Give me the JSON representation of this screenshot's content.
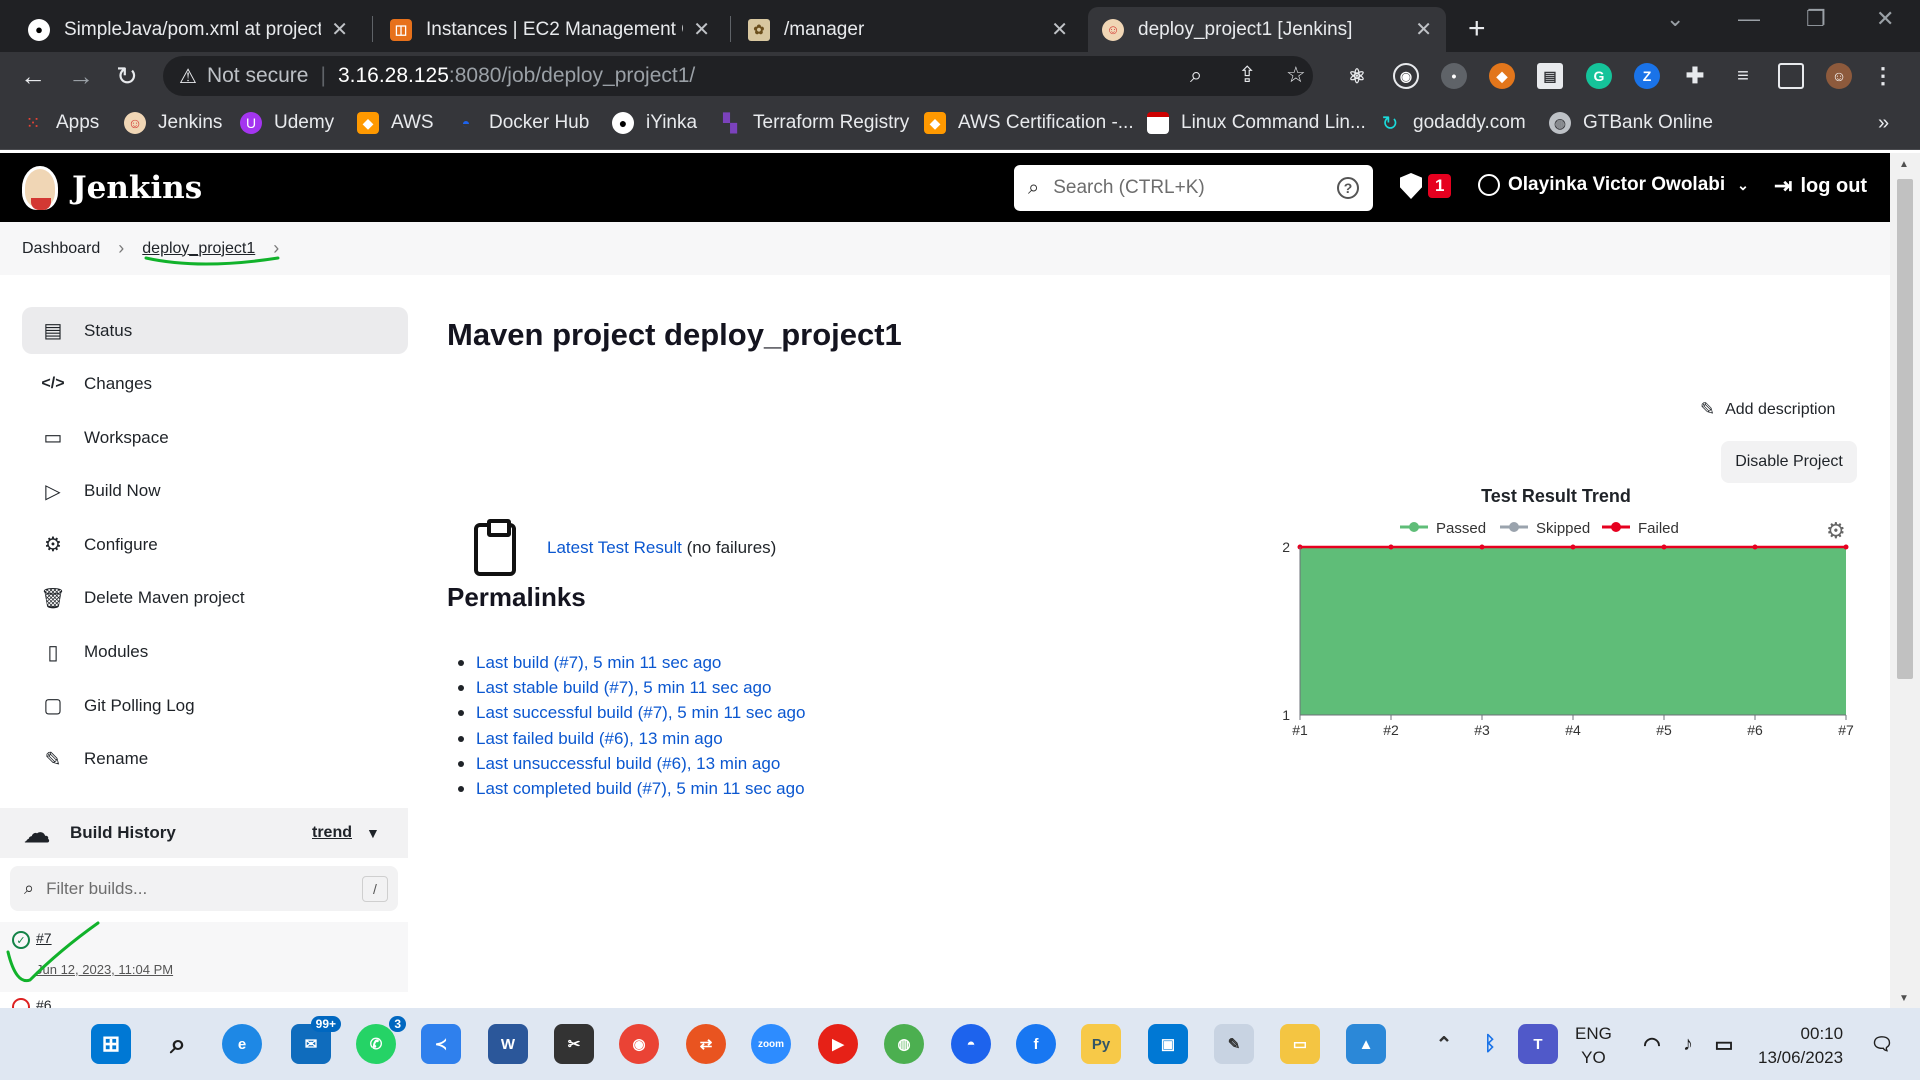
{
  "browser": {
    "tabs": [
      {
        "title": "SimpleJava/pom.xml at project1 ·",
        "favicon": "github-icon"
      },
      {
        "title": "Instances | EC2 Management Con",
        "favicon": "aws-icon"
      },
      {
        "title": "/manager",
        "favicon": "tomcat-icon"
      },
      {
        "title": "deploy_project1 [Jenkins]",
        "favicon": "jenkins-icon"
      }
    ],
    "address": {
      "security": "Not secure",
      "host": "3.16.28.125",
      "path": ":8080/job/deploy_project1/"
    },
    "bookmarks": [
      "Apps",
      "Jenkins",
      "Udemy",
      "AWS",
      "Docker Hub",
      "iYinka",
      "Terraform Registry",
      "AWS Certification -...",
      "Linux Command Lin...",
      "godaddy.com",
      "GTBank Online"
    ],
    "more_bookmarks": "»"
  },
  "jenkins": {
    "brand": "Jenkins",
    "search_placeholder": "Search (CTRL+K)",
    "security_count": "1",
    "user": "Olayinka Victor Owolabi",
    "logout": "log out"
  },
  "breadcrumb": [
    "Dashboard",
    "deploy_project1"
  ],
  "sidebar": {
    "items": [
      {
        "label": "Status",
        "icon": "document-icon"
      },
      {
        "label": "Changes",
        "icon": "code-icon"
      },
      {
        "label": "Workspace",
        "icon": "folder-icon"
      },
      {
        "label": "Build Now",
        "icon": "play-icon"
      },
      {
        "label": "Configure",
        "icon": "gear-icon"
      },
      {
        "label": "Delete Maven project",
        "icon": "trash-icon"
      },
      {
        "label": "Modules",
        "icon": "file-icon"
      },
      {
        "label": "Git Polling Log",
        "icon": "clipboard-icon"
      },
      {
        "label": "Rename",
        "icon": "pencil-icon"
      }
    ],
    "build_history": {
      "title": "Build History",
      "trend": "trend",
      "filter_placeholder": "Filter builds...",
      "filter_key": "/",
      "builds": [
        {
          "number": "#7",
          "date": "Jun 12, 2023, 11:04 PM",
          "status": "success"
        },
        {
          "number": "#6",
          "status": "failed"
        }
      ]
    }
  },
  "main": {
    "title": "Maven project deploy_project1",
    "add_description": "Add description",
    "disable_project": "Disable Project",
    "latest_test_link": "Latest Test Result",
    "latest_test_note": "(no failures)",
    "permalinks_title": "Permalinks",
    "permalinks": [
      "Last build (#7), 5 min 11 sec ago",
      "Last stable build (#7), 5 min 11 sec ago",
      "Last successful build (#7), 5 min 11 sec ago",
      "Last failed build (#6), 13 min ago",
      "Last unsuccessful build (#6), 13 min ago",
      "Last completed build (#7), 5 min 11 sec ago"
    ]
  },
  "chart_data": {
    "type": "area",
    "title": "Test Result Trend",
    "categories": [
      "#1",
      "#2",
      "#3",
      "#4",
      "#5",
      "#6",
      "#7"
    ],
    "series": [
      {
        "name": "Passed",
        "values": [
          2,
          2,
          2,
          2,
          2,
          2,
          2
        ],
        "color": "#5fbd78"
      },
      {
        "name": "Skipped",
        "values": [
          0,
          0,
          0,
          0,
          0,
          0,
          0
        ],
        "color": "#9aa3ad"
      },
      {
        "name": "Failed",
        "values": [
          0,
          0,
          0,
          0,
          0,
          0,
          0
        ],
        "color": "#e6001f"
      }
    ],
    "ylim": [
      1,
      2
    ],
    "yticks": [
      "1",
      "2"
    ],
    "legend": "top-center",
    "grid": false
  },
  "taskbar": {
    "mail_badge": "99+",
    "whatsapp_badge": "3",
    "lang_top": "ENG",
    "lang_bottom": "YO",
    "time": "00:10",
    "date": "13/06/2023"
  }
}
